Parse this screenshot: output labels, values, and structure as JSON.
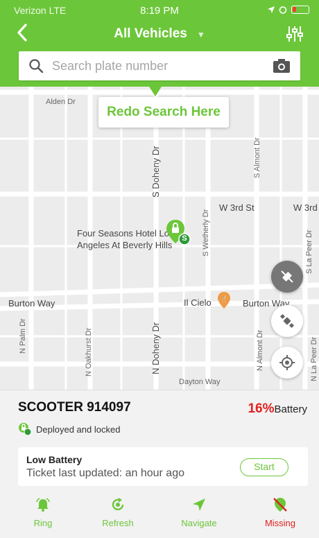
{
  "status_bar": {
    "carrier": "Verizon LTE",
    "time": "8:19 PM"
  },
  "header": {
    "title": "All Vehicles",
    "back_icon": "chevron-left-icon",
    "filter_icon": "sliders-icon"
  },
  "search": {
    "placeholder": "Search plate number",
    "value": ""
  },
  "map": {
    "redo_button": "Redo Search Here",
    "streets": {
      "alden": "Alden Dr",
      "s_doheny": "S Doheny Dr",
      "s_almont": "S Almont Dr",
      "w3rd": "W 3rd St",
      "w3rd_right": "W 3rd",
      "s_wetherly": "S Wetherly Dr",
      "s_la_peer": "S La Peer Dr",
      "burton_left": "Burton Way",
      "burton_right": "Burton Way",
      "n_palm": "N Palm Dr",
      "n_oakhurst": "N Oakhurst Dr",
      "n_doheny": "N Doheny Dr",
      "n_almont": "N Almont Dr",
      "n_la_peer": "N La Peer Dr",
      "dayton": "Dayton Way"
    },
    "poi": {
      "hotel_line1": "Four Seasons Hotel Lo",
      "hotel_line2": "Angeles At Beverly Hills",
      "restaurant": "Il Cielo"
    },
    "marker_badge": "S"
  },
  "vehicle": {
    "name": "SCOOTER 914097",
    "battery_percent": "16%",
    "battery_label": "Battery",
    "state": "Deployed and locked"
  },
  "ticket": {
    "title": "Low Battery",
    "subtitle": "Ticket last updated: an hour ago",
    "start_label": "Start"
  },
  "actions": [
    {
      "label": "Ring",
      "icon": "bell-icon"
    },
    {
      "label": "Refresh",
      "icon": "refresh-icon"
    },
    {
      "label": "Navigate",
      "icon": "navigate-arrow-icon"
    },
    {
      "label": "Missing",
      "icon": "missing-pin-icon"
    }
  ],
  "colors": {
    "brand": "#6cc63a",
    "alert": "#e02020",
    "map_bg": "#ececec"
  }
}
